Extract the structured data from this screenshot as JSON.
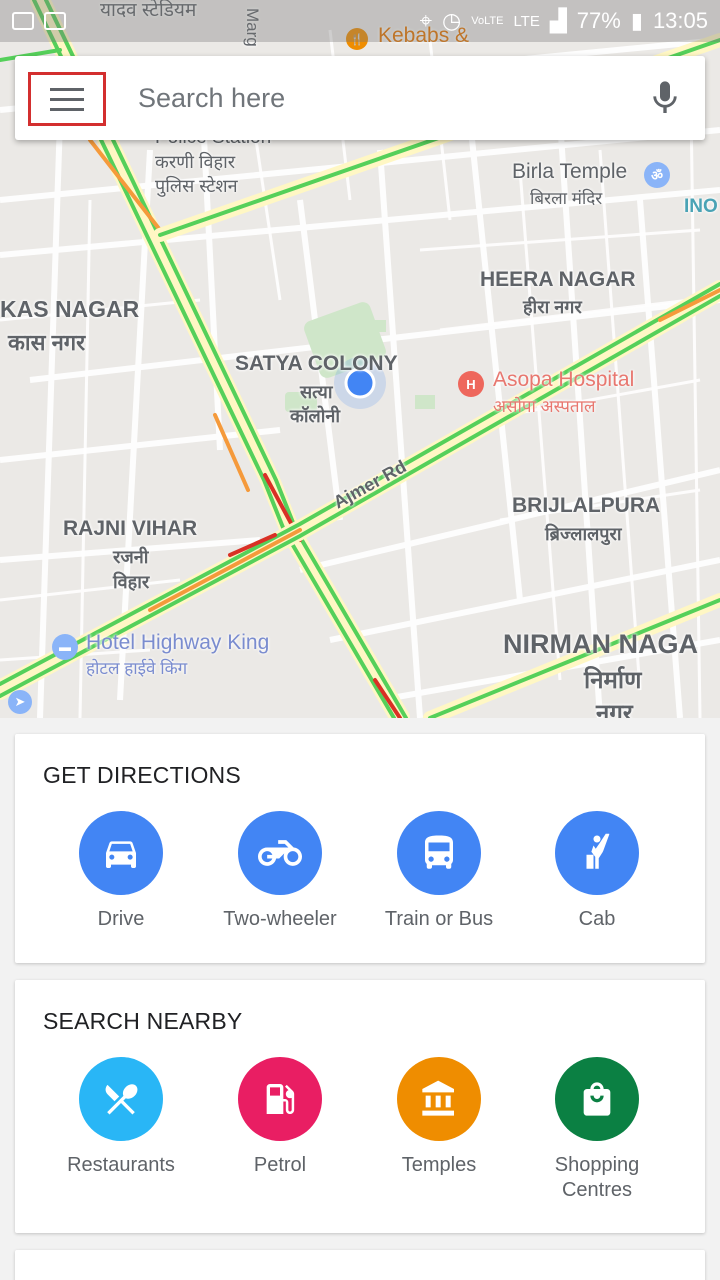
{
  "status_bar": {
    "network": "LTE",
    "battery": "77%",
    "time": "13:05",
    "volte": "VoLTE"
  },
  "search": {
    "placeholder": "Search here",
    "menu_icon": "hamburger-menu-icon",
    "mic_icon": "microphone-icon"
  },
  "map": {
    "labels": {
      "satya_colony": "SATYA COLONY",
      "satya_colony_hi_1": "सत्या",
      "satya_colony_hi_2": "कॉलोनी",
      "heera_nagar": "HEERA NAGAR",
      "heera_nagar_hi": "हीरा नगर",
      "kas_nagar": "KAS NAGAR",
      "kas_nagar_hi": "कास नगर",
      "rajni_vihar": "RAJNI VIHAR",
      "rajni_vihar_hi_1": "रजनी",
      "rajni_vihar_hi_2": "विहार",
      "brijlalpura": "BRIJLALPURA",
      "brijlalpura_hi": "ब्रिज्लालपुरा",
      "nirman_nagar": "NIRMAN NAGA",
      "nirman_nagar_hi_1": "निर्माण",
      "nirman_nagar_hi_2": "नगर",
      "karni_vihar_hi": "करणी विहार",
      "police_station_hi": "पुलिस स्टेशन",
      "police_station": "Police Station",
      "stadium_hi": "यादव स्टेडियम",
      "marg": "Marg",
      "ajmer_rd": "Ajmer Rd",
      "ino": "INO"
    },
    "pois": {
      "birla_temple": "Birla Temple",
      "birla_temple_hi": "बिरला मंदिर",
      "asopa_hospital": "Asopa Hospital",
      "asopa_hospital_hi": "असोपा अस्पताल",
      "hotel_highway_king": "Hotel Highway King",
      "hotel_highway_king_hi": "होटल हाईवे किंग",
      "kebabs": "Kebabs &"
    }
  },
  "get_directions": {
    "title": "GET DIRECTIONS",
    "options": [
      {
        "label": "Drive",
        "icon": "car-icon",
        "color": "#4285f4"
      },
      {
        "label": "Two-wheeler",
        "icon": "motorcycle-icon",
        "color": "#4285f4"
      },
      {
        "label": "Train or Bus",
        "icon": "transit-icon",
        "color": "#4285f4"
      },
      {
        "label": "Cab",
        "icon": "hail-cab-icon",
        "color": "#4285f4"
      }
    ]
  },
  "search_nearby": {
    "title": "SEARCH NEARBY",
    "options": [
      {
        "label": "Restaurants",
        "icon": "restaurant-icon",
        "color": "#29b6f6"
      },
      {
        "label": "Petrol",
        "icon": "petrol-pump-icon",
        "color": "#e91e63"
      },
      {
        "label": "Temples",
        "icon": "temple-icon",
        "color": "#ef8d00"
      },
      {
        "label": "Shopping Centres",
        "icon": "shopping-bag-icon",
        "color": "#0b8043"
      }
    ]
  },
  "colors": {
    "accent_blue": "#4285f4",
    "highlight_red": "#d32f2f",
    "traffic_green": "#55d05a",
    "traffic_orange": "#f59a3b",
    "traffic_red": "#d93025"
  }
}
